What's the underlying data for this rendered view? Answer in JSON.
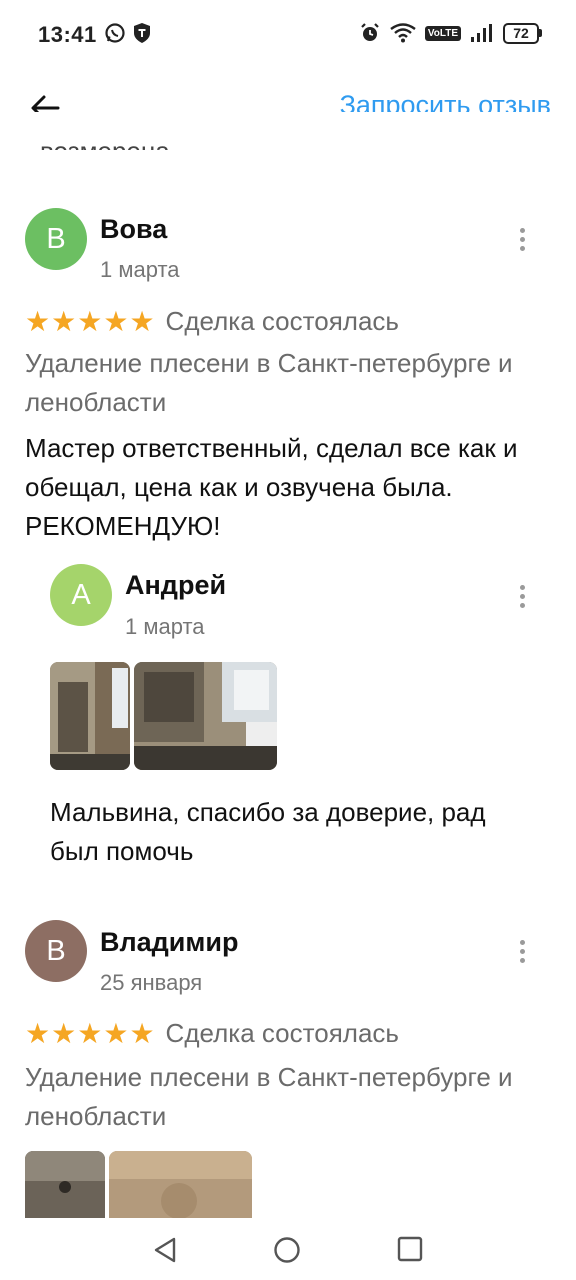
{
  "status": {
    "time": "13:41",
    "volte": "VoLTE",
    "battery": "72"
  },
  "appbar": {
    "request_label": "Запросить отзыв"
  },
  "cut_text": "возмерена",
  "reviews": [
    {
      "avatar_letter": "В",
      "avatar_color": "#6cbf62",
      "author": "Вова",
      "date": "1 марта",
      "deal": "Сделка состоялась",
      "rating": 5,
      "service": "Удаление плесени в Санкт-петербурге и ленобласти",
      "text": "Мастер ответственный, сделал все как и обещал, цена как и озвучена была. РЕКОМЕНДУЮ!",
      "reply": {
        "avatar_letter": "А",
        "avatar_color": "#a5d46b",
        "author": "Андрей",
        "date": "1 марта",
        "text": "Мальвина, спасибо за доверие, рад был помочь"
      }
    },
    {
      "avatar_letter": "В",
      "avatar_color": "#8d6e63",
      "author": "Владимир",
      "date": "25 января",
      "deal": "Сделка состоялась",
      "rating": 5,
      "service": "Удаление плесени в Санкт-петербурге и ленобласти"
    }
  ],
  "icons": {
    "back": "arrow-left-icon",
    "more": "more-vertical-icon",
    "star": "star-icon"
  },
  "colors": {
    "accent": "#2f9bf0",
    "star": "#f5a623"
  }
}
